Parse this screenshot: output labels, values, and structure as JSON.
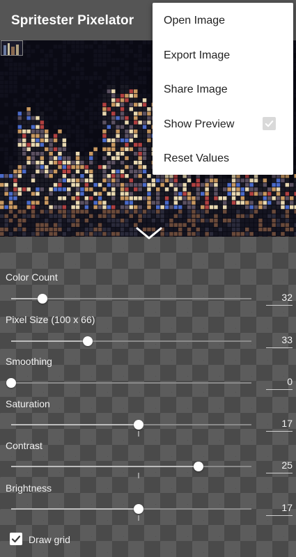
{
  "app": {
    "title": "Spritester Pixelator"
  },
  "menu": {
    "items": [
      {
        "label": "Open Image"
      },
      {
        "label": "Export Image"
      },
      {
        "label": "Share Image"
      },
      {
        "label": "Show Preview",
        "checked": true
      },
      {
        "label": "Reset Values"
      }
    ]
  },
  "controls": {
    "color_count": {
      "label": "Color Count",
      "value": "32",
      "position": 0.13
    },
    "pixel_size": {
      "label": "Pixel Size (100 x 66)",
      "value": "33",
      "position": 0.32
    },
    "smoothing": {
      "label": "Smoothing",
      "value": "0",
      "position": 0.0
    },
    "saturation": {
      "label": "Saturation",
      "value": "17",
      "position": 0.53
    },
    "contrast": {
      "label": "Contrast",
      "value": "25",
      "position": 0.78
    },
    "brightness": {
      "label": "Brightness",
      "value": "17",
      "position": 0.53
    }
  },
  "draw_grid": {
    "label": "Draw grid",
    "checked": true
  },
  "icons": {
    "collapse": "chevron-down-icon",
    "check": "check-icon"
  },
  "colors": {
    "appbar": "#555555",
    "menu_bg": "#ffffff",
    "knob": "#ffffff"
  }
}
